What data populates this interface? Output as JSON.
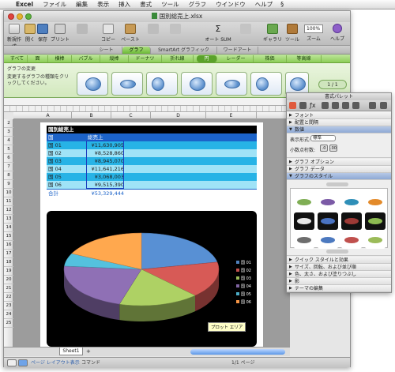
{
  "menubar": {
    "apple": "",
    "items": [
      "Excel",
      "ファイル",
      "編集",
      "表示",
      "挿入",
      "書式",
      "ツール",
      "グラフ",
      "ウインドウ",
      "ヘルプ"
    ],
    "script_icon": "script-icon"
  },
  "window": {
    "title": "国別総売上.xlsx"
  },
  "toolbar": {
    "new_label": "新規作成",
    "open_label": "開く",
    "save_label": "保存",
    "print_label": "プリント",
    "copy_label": "コピー",
    "paste_label": "ペースト",
    "autosum_label": "オート SUM",
    "gallery_label": "ギャラリー",
    "tools_label": "ツール",
    "zoom_label": "ズーム",
    "zoom_value": "100%",
    "help_label": "ヘルプ"
  },
  "ribbon": {
    "tabs": [
      "シート",
      "グラフ",
      "SmartArt グラフィック",
      "ワードアート"
    ],
    "active_tab": "グラフ",
    "subtabs": [
      "すべて",
      "面",
      "横棒",
      "バブル",
      "縦棒",
      "ドーナツ",
      "折れ線",
      "円",
      "レーダー",
      "株価",
      "等高線"
    ],
    "active_subtab": "円",
    "gallery_header": "グラフの変更",
    "gallery_desc": "変更するグラフの種類をクリックしてください。",
    "pager": "1 / 1"
  },
  "columns": [
    "A",
    "B",
    "C",
    "D",
    "E"
  ],
  "rows": [
    "2",
    "3",
    "4",
    "5",
    "6",
    "7",
    "8",
    "9",
    "10",
    "11",
    "12",
    "13",
    "14",
    "15",
    "16",
    "17",
    "18",
    "19",
    "20",
    "21",
    "22",
    "23",
    "24",
    "25"
  ],
  "table": {
    "title": "国別総売上",
    "header": [
      "国",
      "総売上"
    ],
    "rows": [
      [
        "国 01",
        "¥11,630,905"
      ],
      [
        "国 02",
        "¥8,528,860"
      ],
      [
        "国 03",
        "¥8,945,070"
      ],
      [
        "国 04",
        "¥11,641,216"
      ],
      [
        "国 05",
        "¥3,068,003"
      ],
      [
        "国 06",
        "¥9,515,390"
      ]
    ],
    "total": [
      "合計",
      "¥53,329,444"
    ]
  },
  "chart_data": {
    "type": "pie",
    "categories": [
      "国 01",
      "国 02",
      "国 03",
      "国 04",
      "国 05",
      "国 06"
    ],
    "values": [
      11630905,
      8528860,
      8945070,
      11641216,
      3068003,
      9515390
    ],
    "colors": [
      "#4f81bd",
      "#c0504d",
      "#9bbb59",
      "#8064a2",
      "#4bacc6",
      "#f79646"
    ],
    "title": "",
    "legend": "right",
    "tooltip": "プロット エリア"
  },
  "sheet_tabs": [
    "Sheet1"
  ],
  "status": {
    "view": "ページ レイアウト表示",
    "mode": "コマンド",
    "page": "1/1 ページ"
  },
  "palette": {
    "title": "書式パレット",
    "sections": {
      "font": "フォント",
      "align": "配置と間隔",
      "number": "数値",
      "chart_options": "グラフ オプション",
      "chart_data": "グラフ データ",
      "chart_style": "グラフのスタイル",
      "quick_style": "クイック スタイルと効果",
      "size": "サイズ、回転、および並び順",
      "color": "色、太さ、および塗りつぶし",
      "shadow": "影",
      "theme": "テーマの編集"
    },
    "number_format_label": "表示形式:",
    "number_format_value": "標準",
    "decimal_label": "小数点桁数:"
  }
}
